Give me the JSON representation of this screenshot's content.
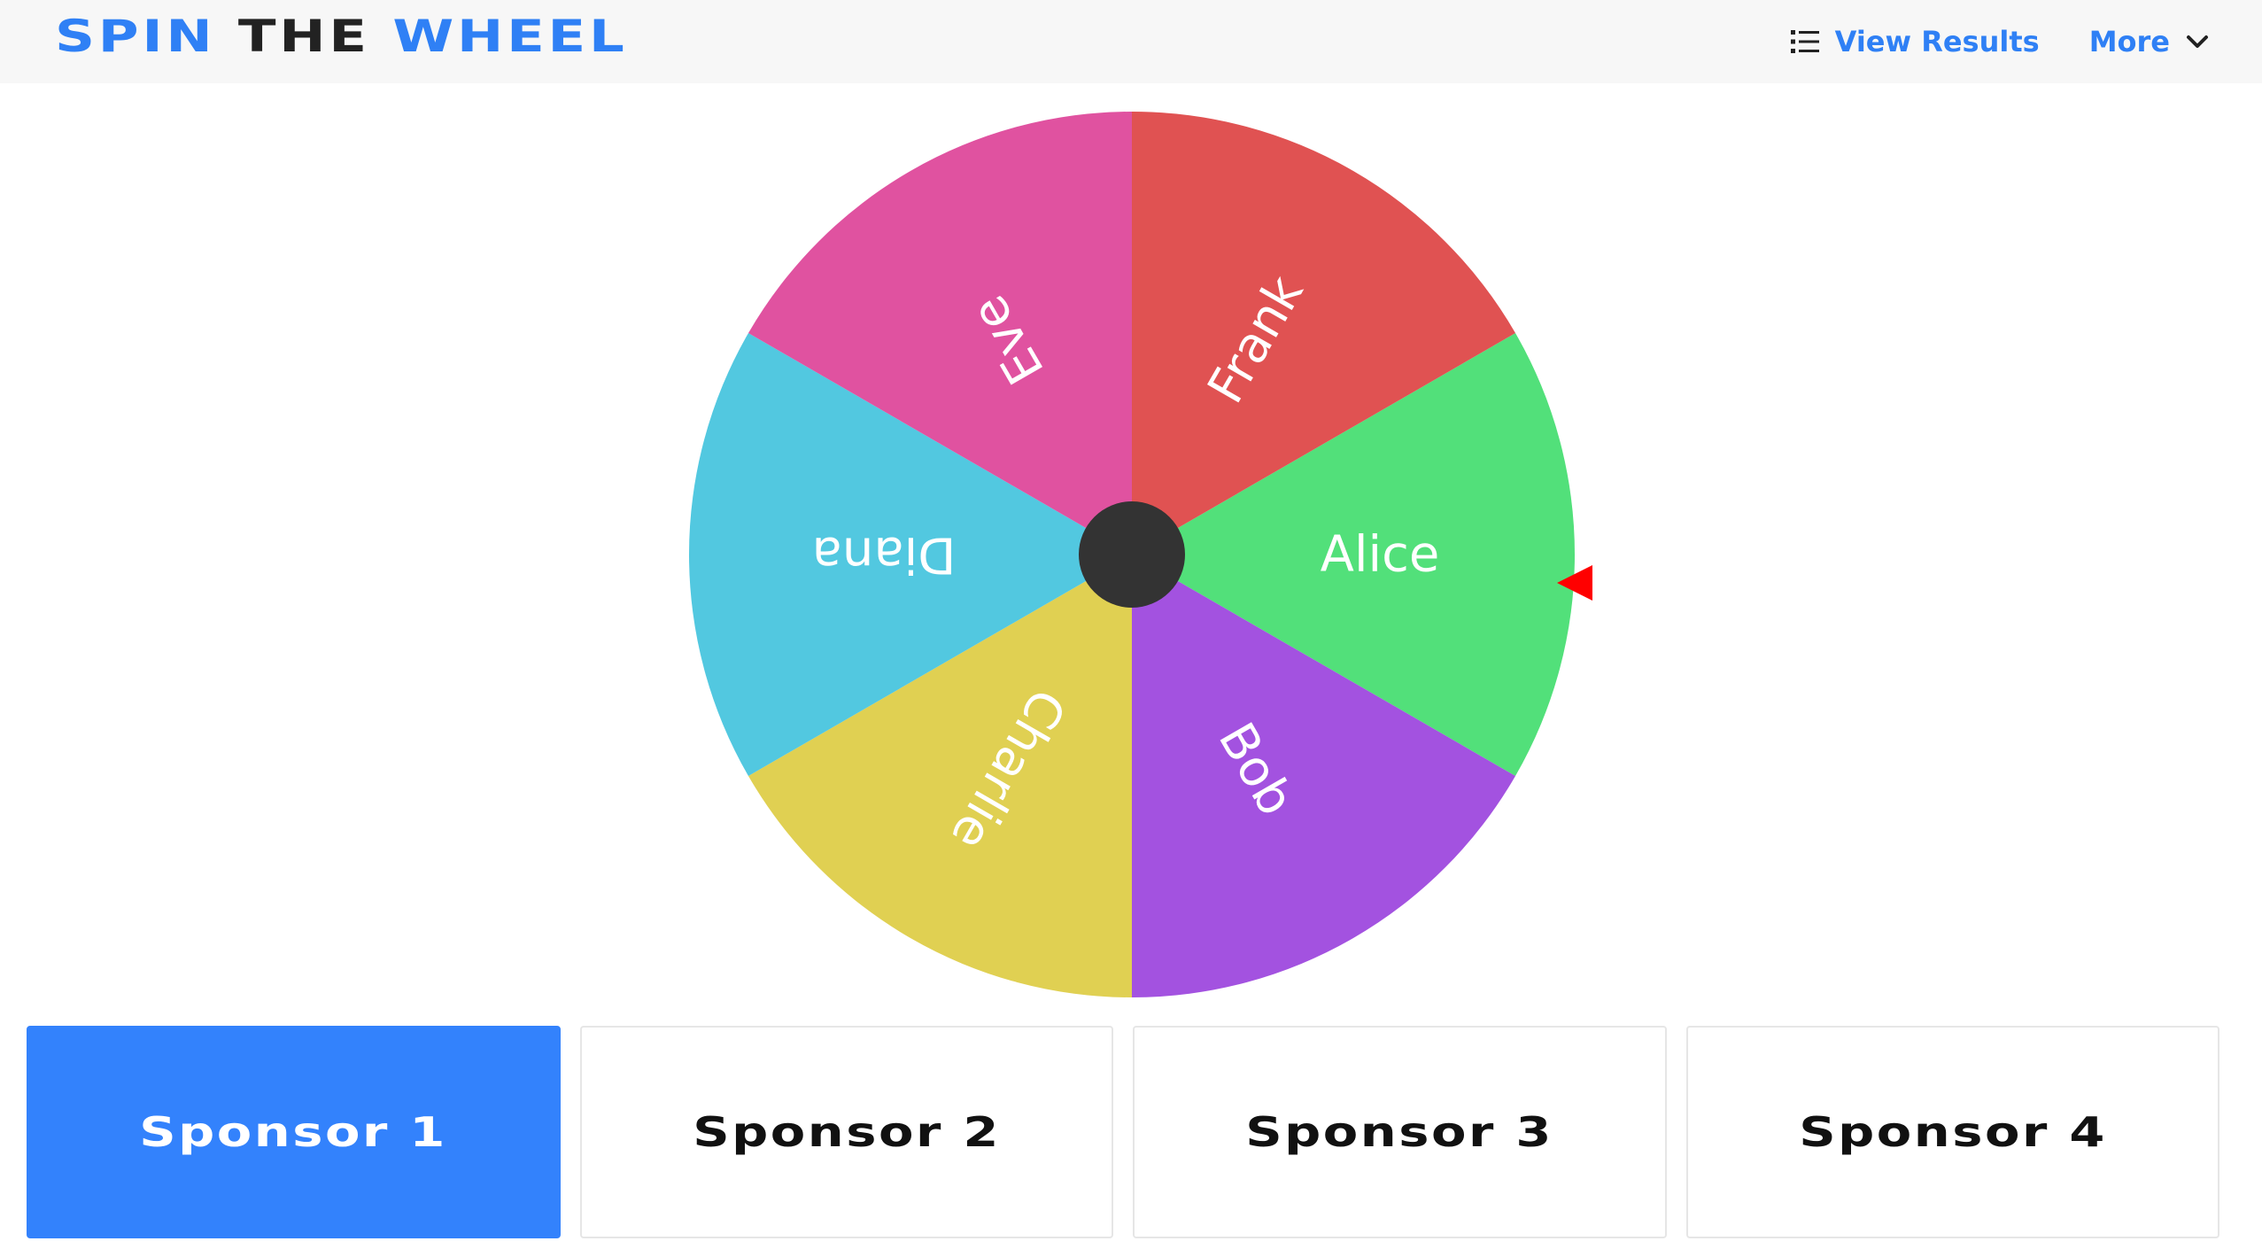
{
  "header": {
    "brand": {
      "word1": "SPIN",
      "word2": "THE",
      "word3": "WHEEL"
    },
    "view_results_label": "View Results",
    "view_results_icon": "list-icon",
    "more_label": "More",
    "more_icon": "chevron-down-icon"
  },
  "wheel": {
    "segments": [
      {
        "label": "Alice",
        "color": "#52e07a"
      },
      {
        "label": "Bob",
        "color": "#a352e0"
      },
      {
        "label": "Charlie",
        "color": "#e0d052"
      },
      {
        "label": "Diana",
        "color": "#52c8e0"
      },
      {
        "label": "Eve",
        "color": "#e052a0"
      },
      {
        "label": "Frank",
        "color": "#e05252"
      }
    ],
    "hub_color": "#333333",
    "pointer_color": "#ff0000",
    "pointer_icon": "triangle-pointer-icon"
  },
  "sponsors": [
    {
      "label": "Sponsor 1",
      "active": true
    },
    {
      "label": "Sponsor 2",
      "active": false
    },
    {
      "label": "Sponsor 3",
      "active": false
    },
    {
      "label": "Sponsor 4",
      "active": false
    }
  ],
  "colors": {
    "accent": "#2f80f5",
    "sponsor_active_bg": "#3382fc",
    "topbar_bg": "#f7f7f7"
  }
}
